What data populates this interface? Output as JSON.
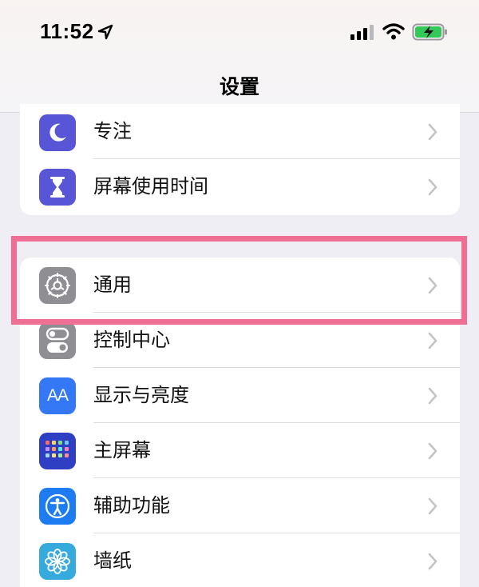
{
  "status_bar": {
    "time": "11:52",
    "icons": [
      "location-arrow-icon",
      "cellular-signal-icon",
      "wifi-icon",
      "battery-charging-icon"
    ]
  },
  "nav": {
    "title": "设置"
  },
  "group1": {
    "items": [
      {
        "label": "专注",
        "icon": "moon-icon",
        "color": "#5856d6"
      },
      {
        "label": "屏幕使用时间",
        "icon": "hourglass-icon",
        "color": "#5856d6"
      }
    ]
  },
  "group2": {
    "items": [
      {
        "label": "通用",
        "icon": "gear-icon",
        "color": "#8e8e93"
      },
      {
        "label": "控制中心",
        "icon": "toggles-icon",
        "color": "#8e8e93"
      },
      {
        "label": "显示与亮度",
        "icon": "text-size-icon",
        "color": "#3478f6"
      },
      {
        "label": "主屏幕",
        "icon": "app-grid-icon",
        "color": "#2f3fc4"
      },
      {
        "label": "辅助功能",
        "icon": "accessibility-icon",
        "color": "#1d7cf2"
      },
      {
        "label": "墙纸",
        "icon": "flower-icon",
        "color": "#36aadc"
      }
    ]
  },
  "highlight": {
    "color": "#ee6f93",
    "target": "通用"
  },
  "display_icon_text": "AA"
}
